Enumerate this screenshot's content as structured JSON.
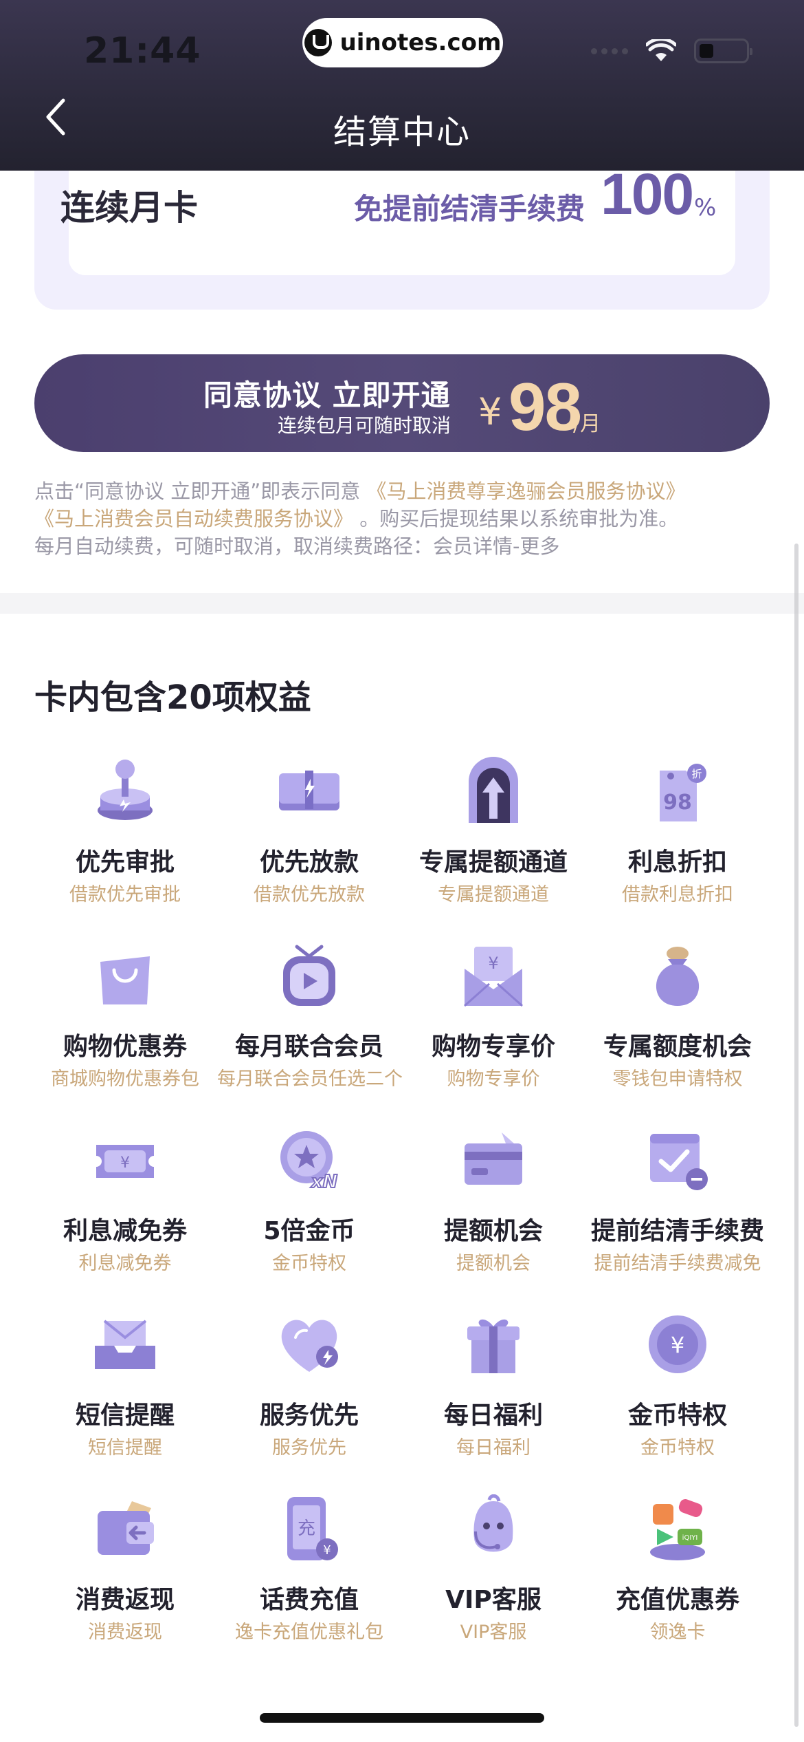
{
  "status_bar": {
    "time": "21:44",
    "watermark": "uinotes.com"
  },
  "nav": {
    "title": "结算中心"
  },
  "plan": {
    "name": "连续月卡",
    "desc": "免提前结清手续费",
    "value": "100",
    "unit": "%"
  },
  "cta": {
    "main": "同意协议 立即开通",
    "sub": "连续包月可随时取消",
    "currency": "¥",
    "price": "98",
    "unit": "/月"
  },
  "agreement": {
    "prefix": "点击“同意协议 立即开通”即表示同意",
    "link1": "《马上消费尊享逸骊会员服务协议》",
    "link2": "《马上消费会员自动续费服务协议》",
    "suffix": "。购买后提现结果以系统审批为准。",
    "line3": "每月自动续费，可随时取消，取消续费路径：会员详情-更多"
  },
  "benefits": {
    "title": "卡内包含20项权益",
    "items": [
      {
        "title": "优先审批",
        "sub": "借款优先审批",
        "icon": "joystick-icon"
      },
      {
        "title": "优先放款",
        "sub": "借款优先放款",
        "icon": "cash-icon"
      },
      {
        "title": "专属提额通道",
        "sub": "专属提额通道",
        "icon": "arrow-gate-icon"
      },
      {
        "title": "利息折扣",
        "sub": "借款利息折扣",
        "icon": "discount-tag-icon"
      },
      {
        "title": "购物优惠券",
        "sub": "商城购物优惠券包",
        "icon": "shopping-bag-icon"
      },
      {
        "title": "每月联合会员",
        "sub": "每月联合会员任选二个",
        "icon": "tv-play-icon"
      },
      {
        "title": "购物专享价",
        "sub": "购物专享价",
        "icon": "envelope-yen-icon"
      },
      {
        "title": "专属额度机会",
        "sub": "零钱包申请特权",
        "icon": "money-bag-icon"
      },
      {
        "title": "利息减免券",
        "sub": "利息减免券",
        "icon": "ticket-icon"
      },
      {
        "title": "5倍金币",
        "sub": "金币特权",
        "icon": "coin-multiplier-icon"
      },
      {
        "title": "提额机会",
        "sub": "提额机会",
        "icon": "card-up-icon"
      },
      {
        "title": "提前结清手续费",
        "sub": "提前结清手续费减免",
        "icon": "calendar-check-icon"
      },
      {
        "title": "短信提醒",
        "sub": "短信提醒",
        "icon": "inbox-icon"
      },
      {
        "title": "服务优先",
        "sub": "服务优先",
        "icon": "heart-bolt-icon"
      },
      {
        "title": "每日福利",
        "sub": "每日福利",
        "icon": "gift-icon"
      },
      {
        "title": "金币特权",
        "sub": "金币特权",
        "icon": "yen-coin-icon"
      },
      {
        "title": "消费返现",
        "sub": "消费返现",
        "icon": "wallet-return-icon"
      },
      {
        "title": "话费充值",
        "sub": "逸卡充值优惠礼包",
        "icon": "phone-recharge-icon"
      },
      {
        "title": "VIP客服",
        "sub": "VIP客服",
        "icon": "headset-mascot-icon"
      },
      {
        "title": "充值优惠券",
        "sub": "领逸卡",
        "icon": "apps-stack-icon"
      }
    ]
  },
  "colors": {
    "header_bg": "#2c2a3c",
    "accent_purple": "#6b5ca8",
    "gold": "#c9a77a",
    "price_gold": "#f4d6ad"
  }
}
